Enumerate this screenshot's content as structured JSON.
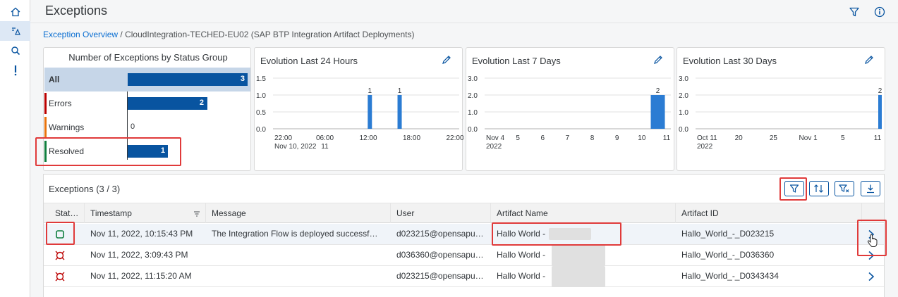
{
  "header": {
    "title": "Exceptions"
  },
  "breadcrumb": {
    "link": "Exception Overview",
    "separator": " / ",
    "current": "CloudIntegration-TECHED-EU02 (SAP BTP Integration Artifact Deployments)"
  },
  "status_group": {
    "title": "Number of Exceptions by Status Group",
    "rows": [
      {
        "label": "All",
        "value": 3,
        "display": "3"
      },
      {
        "label": "Errors",
        "value": 2,
        "display": "2"
      },
      {
        "label": "Warnings",
        "value": 0,
        "display": "0"
      },
      {
        "label": "Resolved",
        "value": 1,
        "display": "1"
      }
    ],
    "colors": {
      "errors": "#bb0000",
      "warnings": "#e9730c",
      "resolved": "#107e3e",
      "bar": "#0854a0",
      "selected": "#c6d6e8"
    }
  },
  "charts": [
    {
      "title": "Evolution Last 24 Hours",
      "chart_data": {
        "type": "bar",
        "title": "Evolution Last 24 Hours",
        "y_ticks": [
          "1.5",
          "1.0",
          "0.5",
          "0.0"
        ],
        "ylim": [
          0,
          1.5
        ],
        "x_ticks": [
          {
            "label": "22:00",
            "sub": "Nov 10, 2022"
          },
          {
            "label": "06:00",
            "sub": "11"
          },
          {
            "label": "12:00",
            "sub": ""
          },
          {
            "label": "18:00",
            "sub": ""
          },
          {
            "label": "22:00",
            "sub": ""
          }
        ],
        "bars": [
          {
            "x_pos": 0.52,
            "value": 1,
            "label": "1"
          },
          {
            "x_pos": 0.68,
            "value": 1,
            "label": "1"
          }
        ]
      }
    },
    {
      "title": "Evolution Last 7 Days",
      "chart_data": {
        "type": "bar",
        "title": "Evolution Last 7 Days",
        "y_ticks": [
          "3.0",
          "2.0",
          "1.0",
          "0.0"
        ],
        "ylim": [
          0,
          3
        ],
        "x_ticks": [
          {
            "label": "Nov 4",
            "sub": "2022"
          },
          {
            "label": "5",
            "sub": ""
          },
          {
            "label": "6",
            "sub": ""
          },
          {
            "label": "7",
            "sub": ""
          },
          {
            "label": "8",
            "sub": ""
          },
          {
            "label": "9",
            "sub": ""
          },
          {
            "label": "10",
            "sub": ""
          },
          {
            "label": "11",
            "sub": ""
          }
        ],
        "bars": [
          {
            "x_pos": 0.93,
            "value": 2,
            "label": "2"
          }
        ]
      }
    },
    {
      "title": "Evolution Last 30 Days",
      "chart_data": {
        "type": "bar",
        "title": "Evolution Last 30 Days",
        "y_ticks": [
          "3.0",
          "2.0",
          "1.0",
          "0.0"
        ],
        "ylim": [
          0,
          3
        ],
        "x_ticks": [
          {
            "label": "Oct 11",
            "sub": "2022"
          },
          {
            "label": "20",
            "sub": ""
          },
          {
            "label": "25",
            "sub": ""
          },
          {
            "label": "Nov 1",
            "sub": ""
          },
          {
            "label": "5",
            "sub": ""
          },
          {
            "label": "11",
            "sub": ""
          }
        ],
        "bars": [
          {
            "x_pos": 0.995,
            "value": 2,
            "label": "2"
          }
        ]
      }
    }
  ],
  "table": {
    "title": "Exceptions (3 / 3)",
    "columns": [
      "Stat…",
      "Timestamp",
      "Message",
      "User",
      "Artifact Name",
      "Artifact ID"
    ],
    "rows": [
      {
        "status": "resolved",
        "timestamp": "Nov 11, 2022, 10:15:43 PM",
        "message": "The Integration Flow is deployed successf…",
        "user": "d023215@opensapu…",
        "artifact_name": "Hallo World -",
        "artifact_id": "Hallo_World_-_D023215"
      },
      {
        "status": "error",
        "timestamp": "Nov 11, 2022, 3:09:43 PM",
        "message": "",
        "user": "d036360@opensapu…",
        "artifact_name": "Hallo World -",
        "artifact_id": "Hallo_World_-_D036360"
      },
      {
        "status": "error",
        "timestamp": "Nov 11, 2022, 11:15:20 AM",
        "message": "",
        "user": "d023215@opensapu…",
        "artifact_name": "Hallo World -",
        "artifact_id": "Hallo_World_-_D0343434"
      }
    ]
  },
  "colors": {
    "accent": "#0a6ed1",
    "brand_dark": "#0854a0",
    "error": "#bb0000",
    "success": "#107e3e",
    "highlight": "#e03a3a"
  }
}
